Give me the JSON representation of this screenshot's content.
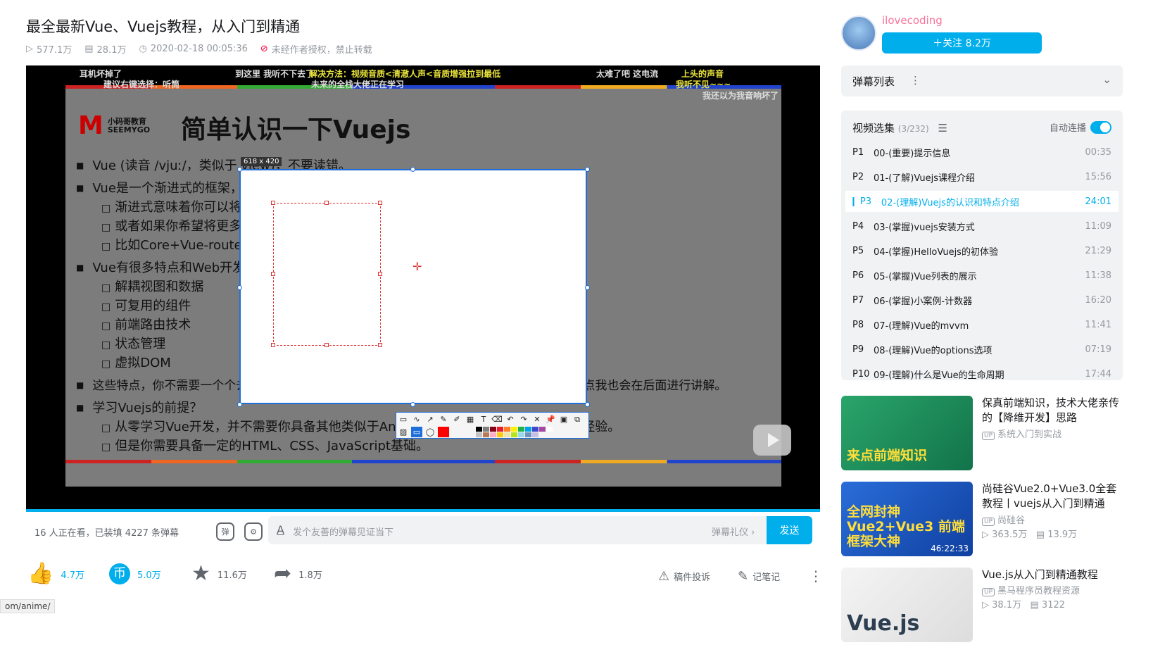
{
  "video": {
    "title": "最全最新Vue、Vuejs教程，从入门到精通",
    "views": "577.1万",
    "danmaku_count": "28.1万",
    "date": "2020-02-18 00:05:36",
    "copyright": "未经作者授权，禁止转载"
  },
  "player": {
    "danmaku": [
      "耳机坏掉了",
      "建议右键选择：听筒",
      "到这里 我听不下去了",
      "解决方法：视频音质<清澈人声<音质增强拉到最低",
      "未来的全栈大佬正在学习",
      "太难了吧 这电流",
      "上头的声音",
      "我听不见~~~",
      "我还以为我音响坏了"
    ],
    "slide": {
      "logo_cn": "小码哥教育",
      "logo_en": "SEEMYGO",
      "title": "简单认识一下Vuejs",
      "lines": [
        "Vue (读音 /vjuː/，类似于 view)，不要读错。",
        "Vue是一个渐进式的框架，什么是渐进式的呢？",
        "渐进式意味着你可以将Vue作为你应用的一部分嵌入其中，带来更丰富的交互体验。",
        "或者如果你希望将更多的业务逻辑使用Vue实现，那么Vue的核心库以及其生态系统。",
        "比如Core+Vue-router+Vuex，也可以满足你各种各样的需求。",
        "Vue有很多特点和Web开发中常见的高级功能",
        "解耦视图和数据",
        "可复用的组件",
        "前端路由技术",
        "状态管理",
        "虚拟DOM",
        "这些特点，你不需要一个个去记住，我们在后面的学习和开发中都会慢慢体会到的，一些技术点我也会在后面进行讲解。",
        "学习Vuejs的前提？",
        "从零学习Vue开发，并不需要你具备其他类似于Angular、React，甚至是jQuery的经验。",
        "但是你需要具备一定的HTML、CSS、JavaScript基础。"
      ]
    },
    "capture_size": "618 x 420",
    "play_icon": "play-icon"
  },
  "danmaku_bar": {
    "viewers": "16 人正在看，已装填 4227 条弹幕",
    "placeholder": "发个友善的弹幕见证当下",
    "etiquette": "弹幕礼仪 ›",
    "send": "发送"
  },
  "actions": {
    "like": "4.7万",
    "coin": "5.0万",
    "favorite": "11.6万",
    "share": "1.8万",
    "report": "稿件投诉",
    "notes": "记笔记"
  },
  "status_url": "om/anime/",
  "uploader": {
    "name": "ilovecoding",
    "follow": "＋关注 8.2万"
  },
  "danmaku_list": {
    "label": "弹幕列表"
  },
  "playlist": {
    "title": "视频选集",
    "count": "(3/232)",
    "autoplay": "自动连播",
    "items": [
      {
        "p": "P1",
        "title": "00-(重要)提示信息",
        "duration": "00:35"
      },
      {
        "p": "P2",
        "title": "01-(了解)Vuejs课程介绍",
        "duration": "15:56"
      },
      {
        "p": "P3",
        "title": "02-(理解)Vuejs的认识和特点介绍",
        "duration": "24:01"
      },
      {
        "p": "P4",
        "title": "03-(掌握)vuejs安装方式",
        "duration": "11:09"
      },
      {
        "p": "P5",
        "title": "04-(掌握)HelloVuejs的初体验",
        "duration": "21:29"
      },
      {
        "p": "P6",
        "title": "05-(掌握)Vue列表的展示",
        "duration": "11:38"
      },
      {
        "p": "P7",
        "title": "06-(掌握)小案例-计数器",
        "duration": "16:20"
      },
      {
        "p": "P8",
        "title": "07-(理解)Vue的mvvm",
        "duration": "11:41"
      },
      {
        "p": "P9",
        "title": "08-(理解)Vue的options选项",
        "duration": "07:19"
      },
      {
        "p": "P10",
        "title": "09-(理解)什么是Vue的生命周期",
        "duration": "17:44"
      }
    ]
  },
  "recommendations": [
    {
      "title": "保真前端知识，技术大佬亲传的【降维开发】思路",
      "up": "系统入门到实战",
      "thumb_text": "来点前端知识",
      "views": "",
      "danmaku": "",
      "duration": ""
    },
    {
      "title": "尚硅谷Vue2.0+Vue3.0全套教程丨vuejs从入门到精通",
      "up": "尚硅谷",
      "thumb_text": "全网封神 Vue2+Vue3 前端框架大神",
      "views": "363.5万",
      "danmaku": "13.9万",
      "duration": "46:22:33"
    },
    {
      "title": "Vue.js从入门到精通教程",
      "up": "黑马程序员教程资源",
      "thumb_text": "Vue.js",
      "views": "38.1万",
      "danmaku": "3122",
      "duration": ""
    }
  ]
}
